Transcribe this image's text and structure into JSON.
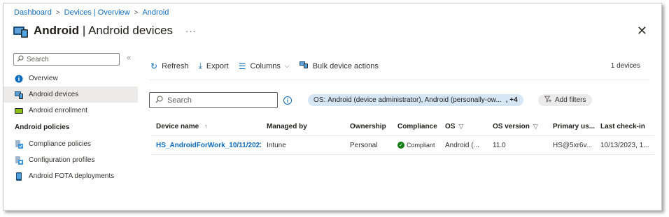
{
  "breadcrumb": [
    "Dashboard",
    "Devices | Overview",
    "Android"
  ],
  "page": {
    "title_bold": "Android",
    "title_rest": " | Android devices",
    "more_label": "···",
    "close_label": "✕"
  },
  "sidebar": {
    "search_placeholder": "Search",
    "collapse_label": "«",
    "items": [
      {
        "label": "Overview",
        "icon": "info-icon",
        "active": false
      },
      {
        "label": "Android devices",
        "icon": "devices-icon",
        "active": true
      },
      {
        "label": "Android enrollment",
        "icon": "enrollment-icon",
        "active": false
      }
    ],
    "section_title": "Android policies",
    "policy_items": [
      {
        "label": "Compliance policies",
        "icon": "compliance-policy-icon"
      },
      {
        "label": "Configuration profiles",
        "icon": "configuration-profile-icon"
      },
      {
        "label": "Android FOTA deployments",
        "icon": "fota-icon"
      }
    ]
  },
  "toolbar": {
    "refresh": "Refresh",
    "export": "Export",
    "columns": "Columns",
    "bulk": "Bulk device actions",
    "count": "1 devices"
  },
  "filters": {
    "search_placeholder": "Search",
    "info": "i",
    "pill_key": "OS:",
    "pill_value": "Android (device administrator), Android (personally-ow...",
    "pill_more": ", +4",
    "add_filters": "Add filters"
  },
  "table": {
    "headers": {
      "device_name": "Device name",
      "managed_by": "Managed by",
      "ownership": "Ownership",
      "compliance": "Compliance",
      "os": "OS",
      "os_version": "OS version",
      "primary_user": "Primary us...",
      "last_checkin": "Last check-in"
    },
    "sort_indicator": "↑",
    "rows": [
      {
        "device_name": "HS_AndroidForWork_10/11/2023...",
        "managed_by": "Intune",
        "ownership": "Personal",
        "compliance": "Compliant",
        "os": "Android (...",
        "os_version": "11.0",
        "primary_user": "HS@5xr6v...",
        "last_checkin": "10/13/2023, 1..."
      }
    ]
  },
  "colors": {
    "accent": "#0f6cbd",
    "compliant": "#107c10",
    "pill_bg": "#d6e6f5"
  }
}
